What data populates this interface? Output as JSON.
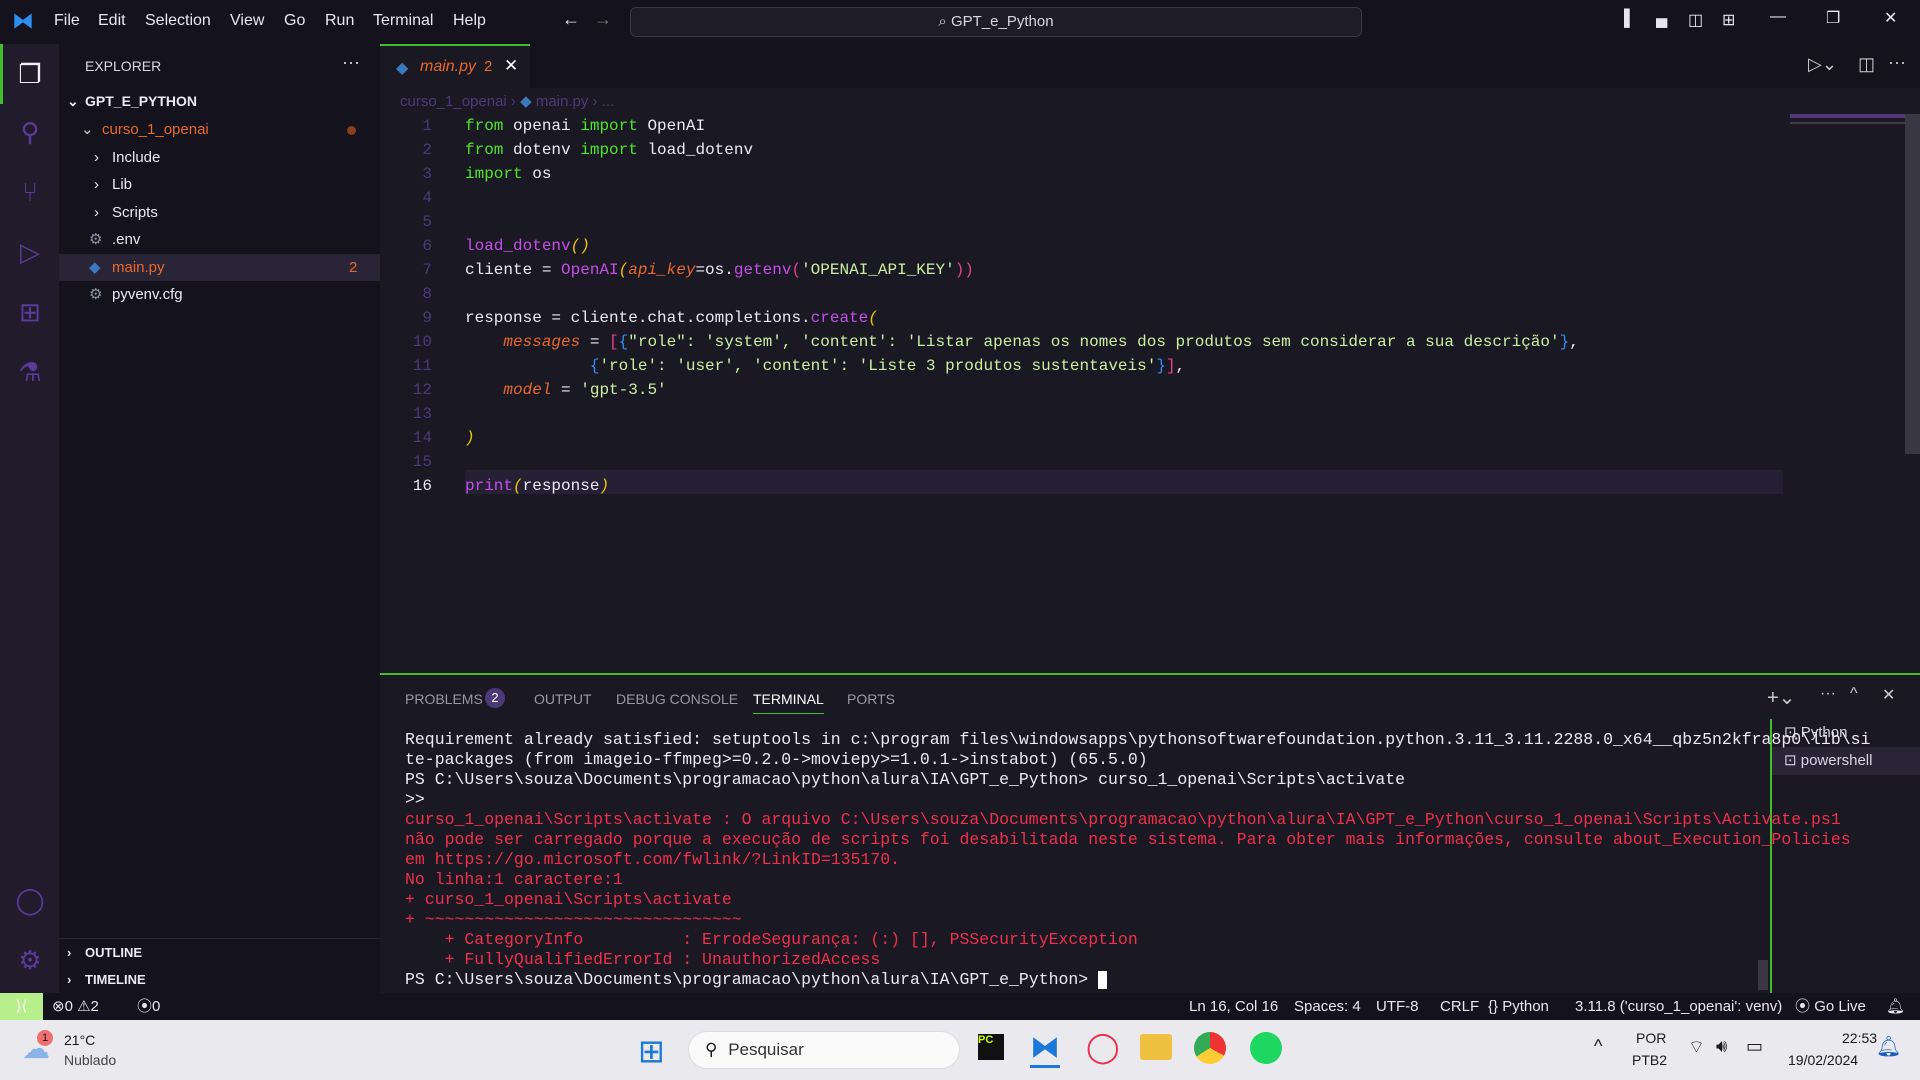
{
  "titlebar": {
    "menu": [
      "File",
      "Edit",
      "Selection",
      "View",
      "Go",
      "Run",
      "Terminal",
      "Help"
    ],
    "search": "GPT_e_Python"
  },
  "explorer": {
    "title": "EXPLORER",
    "root": "GPT_E_PYTHON",
    "items": [
      {
        "label": "curso_1_openai",
        "kind": "folder-open"
      },
      {
        "label": "Include",
        "kind": "folder"
      },
      {
        "label": "Lib",
        "kind": "folder"
      },
      {
        "label": "Scripts",
        "kind": "folder"
      },
      {
        "label": ".env",
        "kind": "gear"
      },
      {
        "label": "main.py",
        "kind": "python",
        "badge": "2"
      },
      {
        "label": "pyvenv.cfg",
        "kind": "gear"
      }
    ],
    "outline": "OUTLINE",
    "timeline": "TIMELINE"
  },
  "tab": {
    "label": "main.py",
    "badge": "2"
  },
  "breadcrumb": {
    "folder": "curso_1_openai",
    "file": "main.py",
    "more": "..."
  },
  "code": [
    [
      [
        "from ",
        "kw"
      ],
      [
        "openai ",
        ""
      ],
      [
        "import ",
        "kw"
      ],
      [
        "OpenAI",
        ""
      ]
    ],
    [
      [
        "from ",
        "kw"
      ],
      [
        "dotenv ",
        ""
      ],
      [
        "import ",
        "kw"
      ],
      [
        "load_dotenv",
        ""
      ]
    ],
    [
      [
        "import ",
        "kw"
      ],
      [
        "os",
        ""
      ]
    ],
    [],
    [],
    [
      [
        "load_dotenv",
        "fn"
      ],
      [
        "()",
        "par"
      ]
    ],
    [
      [
        "cliente = ",
        ""
      ],
      [
        "OpenAI",
        "fn"
      ],
      [
        "(",
        "par"
      ],
      [
        "api_key",
        "param"
      ],
      [
        "=os.",
        ""
      ],
      [
        "getenv",
        "fn"
      ],
      [
        "(",
        "pk"
      ],
      [
        "'OPENAI_API_KEY'",
        "str"
      ],
      [
        "))",
        "pk"
      ]
    ],
    [],
    [
      [
        "response = cliente.chat.completions.",
        ""
      ],
      [
        "create",
        "fn"
      ],
      [
        "(",
        "par"
      ]
    ],
    [
      [
        "    ",
        ""
      ],
      [
        "messages",
        "param"
      ],
      [
        " = ",
        ""
      ],
      [
        "[",
        "pk"
      ],
      [
        "{",
        "br"
      ],
      [
        "\"role\": 'system', 'content': 'Listar apenas os nomes dos produtos sem considerar a sua descrição'",
        "str"
      ],
      [
        "}",
        "br"
      ],
      [
        ",",
        ""
      ]
    ],
    [
      [
        "             ",
        ""
      ],
      [
        "{",
        "br"
      ],
      [
        "'role': 'user', 'content': 'Liste 3 produtos sustentaveis'",
        "str"
      ],
      [
        "}",
        "br"
      ],
      [
        "]",
        "pk"
      ],
      [
        ",",
        ""
      ]
    ],
    [
      [
        "    ",
        ""
      ],
      [
        "model",
        "param"
      ],
      [
        " = ",
        ""
      ],
      [
        "'gpt-3.5'",
        "str"
      ]
    ],
    [],
    [
      [
        ")",
        "par"
      ]
    ],
    [],
    [
      [
        "print",
        "fn"
      ],
      [
        "(",
        "par"
      ],
      [
        "response",
        ""
      ],
      [
        ")",
        "par"
      ]
    ]
  ],
  "panel": {
    "tabs": [
      "PROBLEMS",
      "OUTPUT",
      "DEBUG CONSOLE",
      "TERMINAL",
      "PORTS"
    ],
    "problems_count": "2",
    "active": "TERMINAL",
    "terminals": [
      "Python",
      "powershell"
    ]
  },
  "terminal": [
    [
      "Requirement already satisfied: setuptools in c:\\program files\\windowsapps\\pythonsoftwarefoundation.python.3.11_3.11.2288.0_x64__qbz5n2kfra8p0\\lib\\si",
      ""
    ],
    [
      "te-packages (from imageio-ffmpeg>=0.2.0->moviepy>=1.0.1->instabot) (65.5.0)",
      ""
    ],
    [
      "PS C:\\Users\\souza\\Documents\\programacao\\python\\alura\\IA\\GPT_e_Python> curso_1_openai\\Scripts\\activate",
      ""
    ],
    [
      ">>",
      ""
    ],
    [
      "curso_1_openai\\Scripts\\activate : O arquivo C:\\Users\\souza\\Documents\\programacao\\python\\alura\\IA\\GPT_e_Python\\curso_1_openai\\Scripts\\Activate.ps1",
      "err"
    ],
    [
      "não pode ser carregado porque a execução de scripts foi desabilitada neste sistema. Para obter mais informações, consulte about_Execution_Policies",
      "err"
    ],
    [
      "em https://go.microsoft.com/fwlink/?LinkID=135170.",
      "err"
    ],
    [
      "No linha:1 caractere:1",
      "err"
    ],
    [
      "+ curso_1_openai\\Scripts\\activate",
      "err"
    ],
    [
      "+ ~~~~~~~~~~~~~~~~~~~~~~~~~~~~~~~~",
      "err"
    ],
    [
      "    + CategoryInfo          : ErrodeSegurança: (:) [], PSSecurityException",
      "err"
    ],
    [
      "    + FullyQualifiedErrorId : UnauthorizedAccess",
      "err"
    ],
    [
      "PS C:\\Users\\souza\\Documents\\programacao\\python\\alura\\IA\\GPT_e_Python> ",
      ""
    ]
  ],
  "status": {
    "errors": "0",
    "warnings": "2",
    "ports": "0",
    "position": "Ln 16, Col 16",
    "spaces": "Spaces: 4",
    "encoding": "UTF-8",
    "eol": "CRLF",
    "language": "Python",
    "interpreter": "3.11.8 ('curso_1_openai': venv)",
    "golive": "Go Live"
  },
  "taskbar": {
    "temp": "21°C",
    "weather": "Nublado",
    "weather_badge": "1",
    "search": "Pesquisar",
    "lang1": "POR",
    "lang2": "PTB2",
    "time": "22:53",
    "date": "19/02/2024"
  },
  "colors": {
    "accent": "#3fbf2f",
    "error": "#f0304a",
    "modified": "#e8692a"
  }
}
